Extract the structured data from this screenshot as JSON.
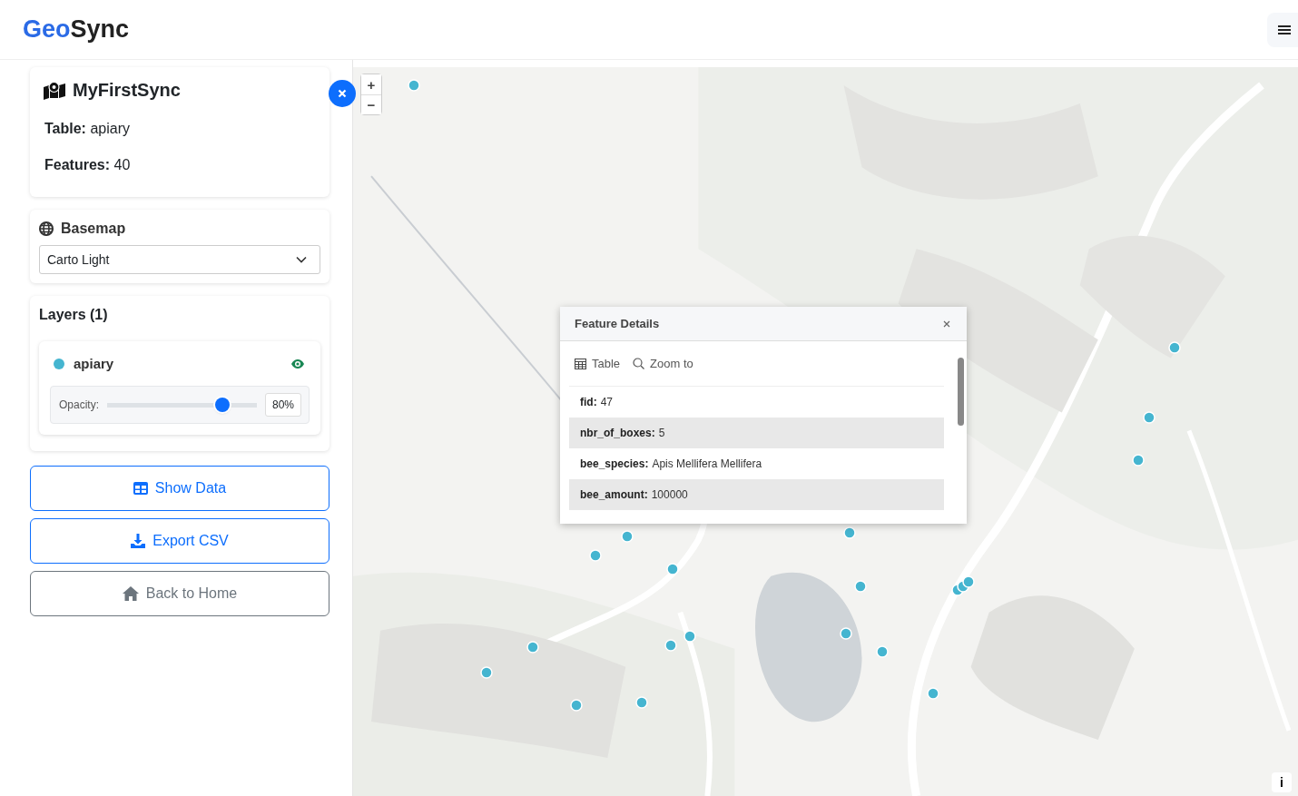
{
  "header": {
    "logo_accent": "Geo",
    "logo_rest": "Sync"
  },
  "sync": {
    "title": "MyFirstSync",
    "fields": [
      {
        "label": "Table:",
        "value": "apiary"
      },
      {
        "label": "Features:",
        "value": "40"
      }
    ]
  },
  "basemap": {
    "title": "Basemap",
    "value": "Carto Light"
  },
  "layers": {
    "title": "Layers (1)",
    "items": [
      {
        "name": "apiary",
        "color": "#45b5d0",
        "visible": true,
        "opacity_label": "Opacity:",
        "level": 0.77,
        "reading": "80%"
      }
    ]
  },
  "buttons": [
    {
      "kind": "data",
      "label": "Show Data"
    },
    {
      "kind": "export",
      "label": "Export CSV"
    },
    {
      "kind": "home",
      "label": "Back to Home"
    }
  ],
  "map": {
    "zoom_in": "+",
    "zoom_out": "−",
    "info": "i"
  },
  "popup": {
    "title": "Feature Details",
    "actions": [
      {
        "kind": "table",
        "label": "Table"
      },
      {
        "kind": "zoom",
        "label": "Zoom to"
      }
    ],
    "rows": [
      {
        "key": "fid:",
        "value": "47"
      },
      {
        "key": "nbr_of_boxes:",
        "value": "5"
      },
      {
        "key": "bee_species:",
        "value": "Apis Mellifera Mellifera"
      },
      {
        "key": "bee_amount:",
        "value": "100000"
      }
    ]
  }
}
